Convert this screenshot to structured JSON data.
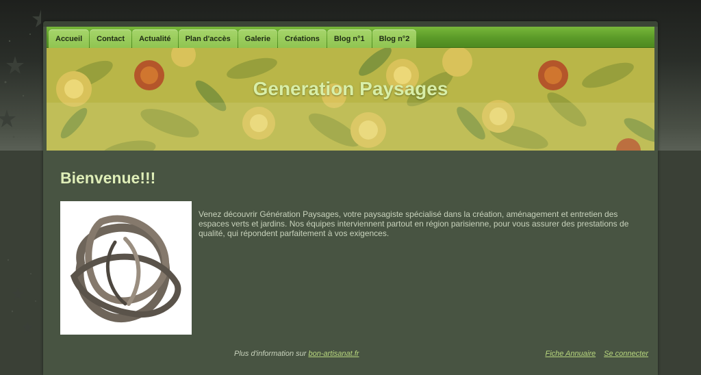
{
  "nav": {
    "items": [
      {
        "label": "Accueil"
      },
      {
        "label": "Contact"
      },
      {
        "label": "Actualité"
      },
      {
        "label": "Plan d'accès"
      },
      {
        "label": "Galerie"
      },
      {
        "label": "Créations"
      },
      {
        "label": "Blog n°1"
      },
      {
        "label": "Blog n°2"
      }
    ]
  },
  "banner": {
    "site_title": "Generation Paysages"
  },
  "main": {
    "heading": "Bienvenue!!!",
    "intro": "Venez découvrir Génération Paysages, votre paysagiste spécialisé dans la création, aménagement et entretien des espaces verts et jardins. Nos équipes interviennent partout en région parisienne, pour vous assurer des prestations de qualité, qui répondent parfaitement à vos exigences."
  },
  "footer": {
    "more_info_prefix": "Plus d'information sur ",
    "more_info_link": "bon-artisanat.fr",
    "directory_link": "Fiche Annuaire",
    "login_link": "Se connecter"
  },
  "colors": {
    "nav_bar": "#5b9a28",
    "nav_tab": "#a6d56a",
    "page_bg": "#485442",
    "heading": "#dfeeb8",
    "link": "#b8d77e"
  }
}
